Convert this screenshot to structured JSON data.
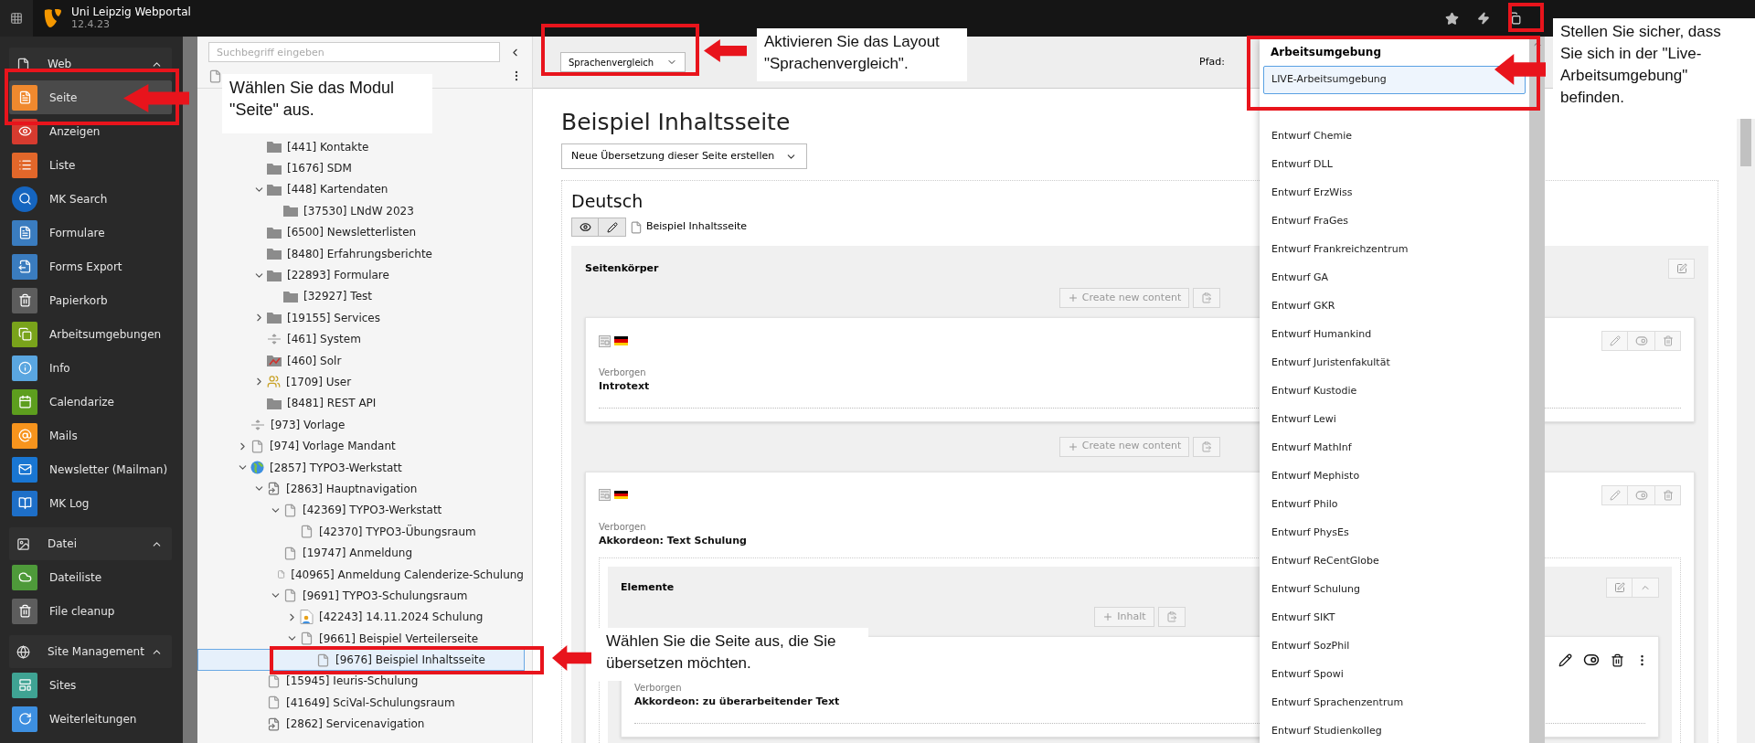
{
  "topbar": {
    "title": "Uni Leipzig Webportal",
    "version": "12.4.23"
  },
  "module_menu": [
    {
      "label": "Web",
      "expanded": true,
      "items": [
        {
          "label": "Seite",
          "selected": true
        },
        {
          "label": "Anzeigen",
          "selected": false
        },
        {
          "label": "Liste",
          "selected": false
        },
        {
          "label": "MK Search",
          "selected": false
        },
        {
          "label": "Formulare",
          "selected": false
        },
        {
          "label": "Forms Export",
          "selected": false
        },
        {
          "label": "Papierkorb",
          "selected": false
        },
        {
          "label": "Arbeitsumgebungen",
          "selected": false
        },
        {
          "label": "Info",
          "selected": false
        },
        {
          "label": "Calendarize",
          "selected": false
        },
        {
          "label": "Mails",
          "selected": false
        },
        {
          "label": "Newsletter (Mailman)",
          "selected": false
        },
        {
          "label": "MK Log",
          "selected": false
        }
      ]
    },
    {
      "label": "Datei",
      "expanded": true,
      "items": [
        {
          "label": "Dateiliste",
          "selected": false
        },
        {
          "label": "File cleanup",
          "selected": false
        }
      ]
    },
    {
      "label": "Site Management",
      "expanded": true,
      "items": [
        {
          "label": "Sites",
          "selected": false
        },
        {
          "label": "Weiterleitungen",
          "selected": false
        }
      ]
    }
  ],
  "page_tree": {
    "search": {
      "placeholder": "Suchbegriff eingeben"
    },
    "nodes": [
      {
        "children": [
          {
            "label": "[441] Kontakte",
            "kind": "folder",
            "selected": false
          },
          {
            "label": "[1676] SDM",
            "kind": "folder",
            "selected": false
          },
          {
            "label": "[448] Kartendaten",
            "kind": "folder",
            "expanded": true,
            "selected": false,
            "children": [
              {
                "label": "[37530] LNdW 2023",
                "kind": "folder",
                "selected": false
              }
            ]
          },
          {
            "label": "[6500] Newsletterlisten",
            "kind": "folder",
            "selected": false
          },
          {
            "label": "[8480] Erfahrungsberichte",
            "kind": "folder",
            "selected": false
          },
          {
            "label": "[22893] Formulare",
            "kind": "folder",
            "expanded": true,
            "selected": false,
            "children": [
              {
                "label": "[32927] Test",
                "kind": "folder",
                "selected": false
              }
            ]
          },
          {
            "label": "[19155] Services",
            "kind": "folder",
            "expanded": false,
            "selected": false
          },
          {
            "label": "[461] System",
            "kind": "spacer",
            "selected": false
          },
          {
            "label": "[460] Solr",
            "kind": "plugin",
            "selected": false
          },
          {
            "label": "[1709] User",
            "kind": "users",
            "expanded": false,
            "selected": false
          },
          {
            "label": "[8481] REST API",
            "kind": "folder",
            "selected": false
          }
        ]
      },
      {
        "label": "[973] Vorlage",
        "kind": "spacer",
        "selected": false
      },
      {
        "label": "[974] Vorlage Mandant",
        "kind": "page",
        "expanded": false,
        "selected": false
      },
      {
        "label": "[2857] TYPO3-Werkstatt",
        "kind": "site",
        "expanded": true,
        "selected": false,
        "children": [
          {
            "label": "[2863] Hauptnavigation",
            "kind": "shortcut",
            "expanded": true,
            "selected": false,
            "children": [
              {
                "label": "[42369] TYPO3-Werkstatt",
                "kind": "page",
                "expanded": true,
                "selected": false,
                "children": [
                  {
                    "label": "[42370] TYPO3-Übungsraum",
                    "kind": "page",
                    "selected": false
                  }
                ]
              },
              {
                "label": "[19747] Anmeldung",
                "kind": "page",
                "selected": false
              },
              {
                "label": "[40965] Anmeldung Calenderize-Schulung",
                "kind": "page",
                "selected": false
              },
              {
                "label": "[9691] TYPO3-Schulungsraum",
                "kind": "page",
                "expanded": true,
                "selected": false,
                "children": [
                  {
                    "label": "[42243] 14.11.2024 Schulung",
                    "kind": "event",
                    "expanded": false,
                    "selected": false
                  },
                  {
                    "label": "[9661] Beispiel Verteilerseite",
                    "kind": "page",
                    "expanded": true,
                    "selected": false,
                    "children": [
                      {
                        "label": "[9676] Beispiel Inhaltsseite",
                        "kind": "page",
                        "selected": true
                      }
                    ]
                  }
                ]
              }
            ]
          },
          {
            "label": "[15945] Ieuris-Schulung",
            "kind": "page",
            "selected": false
          },
          {
            "label": "[41649] SciVal-Schulungsraum",
            "kind": "page",
            "selected": false
          },
          {
            "label": "[2862] Servicenavigation",
            "kind": "shortcut",
            "selected": false
          }
        ]
      }
    ]
  },
  "doc_header": {
    "layout_select": "Sprachenvergleich",
    "path_label": "Pfad:"
  },
  "page": {
    "title": "Beispiel Inhaltsseite",
    "translate_select": "Neue Übersetzung dieser Seite erstellen",
    "language": "Deutsch",
    "page_link": "Beispiel Inhaltsseite",
    "content_area": {
      "title": "Seitenkörper",
      "add_button": "Create new content",
      "elements": [
        {
          "status": "Verborgen",
          "title": "Introtext",
          "add_button": "Create new content"
        },
        {
          "status": "Verborgen",
          "title": "Akkordeon: Text Schulung",
          "container": {
            "title": "Elemente",
            "add_button": "Inhalt",
            "elements": [
              {
                "status": "Verborgen",
                "title": "Akkordeon: zu überarbeitender Text"
              }
            ]
          }
        }
      ]
    }
  },
  "workspace_menu": {
    "title": "Arbeitsumgebung",
    "items": [
      {
        "label": "LIVE-Arbeitsumgebung",
        "selected": true
      },
      {
        "label": "Entwurf Chemie",
        "selected": false
      },
      {
        "label": "Entwurf DLL",
        "selected": false
      },
      {
        "label": "Entwurf ErzWiss",
        "selected": false
      },
      {
        "label": "Entwurf FraGes",
        "selected": false
      },
      {
        "label": "Entwurf Frankreichzentrum",
        "selected": false
      },
      {
        "label": "Entwurf GA",
        "selected": false
      },
      {
        "label": "Entwurf GKR",
        "selected": false
      },
      {
        "label": "Entwurf Humankind",
        "selected": false
      },
      {
        "label": "Entwurf Juristenfakultät",
        "selected": false
      },
      {
        "label": "Entwurf Kustodie",
        "selected": false
      },
      {
        "label": "Entwurf Lewi",
        "selected": false
      },
      {
        "label": "Entwurf MathInf",
        "selected": false
      },
      {
        "label": "Entwurf Mephisto",
        "selected": false
      },
      {
        "label": "Entwurf Philo",
        "selected": false
      },
      {
        "label": "Entwurf PhysEs",
        "selected": false
      },
      {
        "label": "Entwurf ReCentGlobe",
        "selected": false
      },
      {
        "label": "Entwurf Schulung",
        "selected": false
      },
      {
        "label": "Entwurf SIKT",
        "selected": false
      },
      {
        "label": "Entwurf SozPhil",
        "selected": false
      },
      {
        "label": "Entwurf Spowi",
        "selected": false
      },
      {
        "label": "Entwurf Sprachenzentrum",
        "selected": false
      },
      {
        "label": "Entwurf Studienkolleg",
        "selected": false
      }
    ]
  },
  "callouts": [
    {
      "text": "Wählen Sie das Modul \"Seite\" aus."
    },
    {
      "text": "Aktivieren Sie das Layout \"Sprachenvergleich\"."
    },
    {
      "text": "Stellen Sie sicher, dass Sie sich in der \"Live-Arbeitsumgebung\" befinden."
    },
    {
      "text": "Wählen Sie die Seite aus, die Sie übersetzen möchten."
    }
  ]
}
